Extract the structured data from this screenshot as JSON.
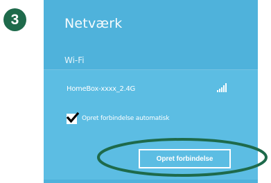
{
  "step": {
    "number": "3",
    "badge_color": "#1e6a4b"
  },
  "panel": {
    "title": "Netværk",
    "background_color": "#4fb2db",
    "section_header": "Wi-Fi"
  },
  "network": {
    "name": "HomeBox-xxxx_2.4G",
    "signal_icon": "wifi-signal-icon",
    "auto_connect_label": "Opret forbindelse automatisk",
    "auto_connect_checked": true,
    "connect_button_label": "Opret forbindelse"
  },
  "annotation": {
    "highlight_color": "#1e6a4b",
    "highlight_target": "connect-button"
  }
}
